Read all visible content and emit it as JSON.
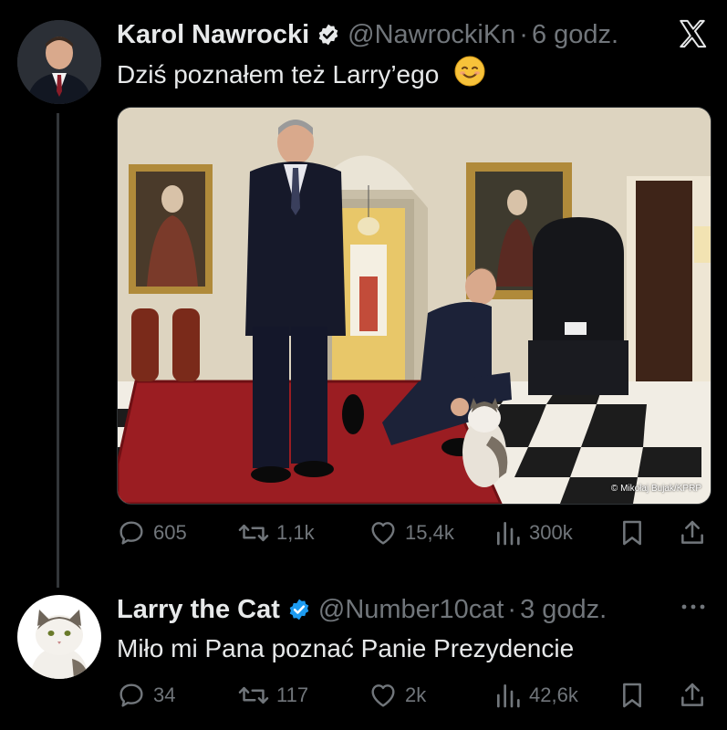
{
  "tweet1": {
    "name": "Karol Nawrocki",
    "handle": "@NawrockiKn",
    "separator": "·",
    "time": "6 godz.",
    "text": "Dziś poznałem też Larry’ego",
    "emoji": "☺️",
    "photo_credit": "© Mikołaj Bujak/KPRP",
    "stats": {
      "replies": "605",
      "reposts": "1,1k",
      "likes": "15,4k",
      "views": "300k"
    }
  },
  "tweet2": {
    "name": "Larry the Cat",
    "handle": "@Number10cat",
    "separator": "·",
    "time": "3 godz.",
    "text": "Miło mi Pana poznać Panie Prezydencie",
    "stats": {
      "replies": "34",
      "reposts": "117",
      "likes": "2k",
      "views": "42,6k"
    }
  },
  "colors": {
    "background": "#000000",
    "text": "#e7e9ea",
    "muted": "#71767b",
    "verified": "#1d9bf0"
  },
  "icons": [
    "x-logo-icon",
    "verified-badge-icon",
    "reply-icon",
    "repost-icon",
    "like-icon",
    "views-icon",
    "bookmark-icon",
    "share-icon",
    "more-icon"
  ]
}
